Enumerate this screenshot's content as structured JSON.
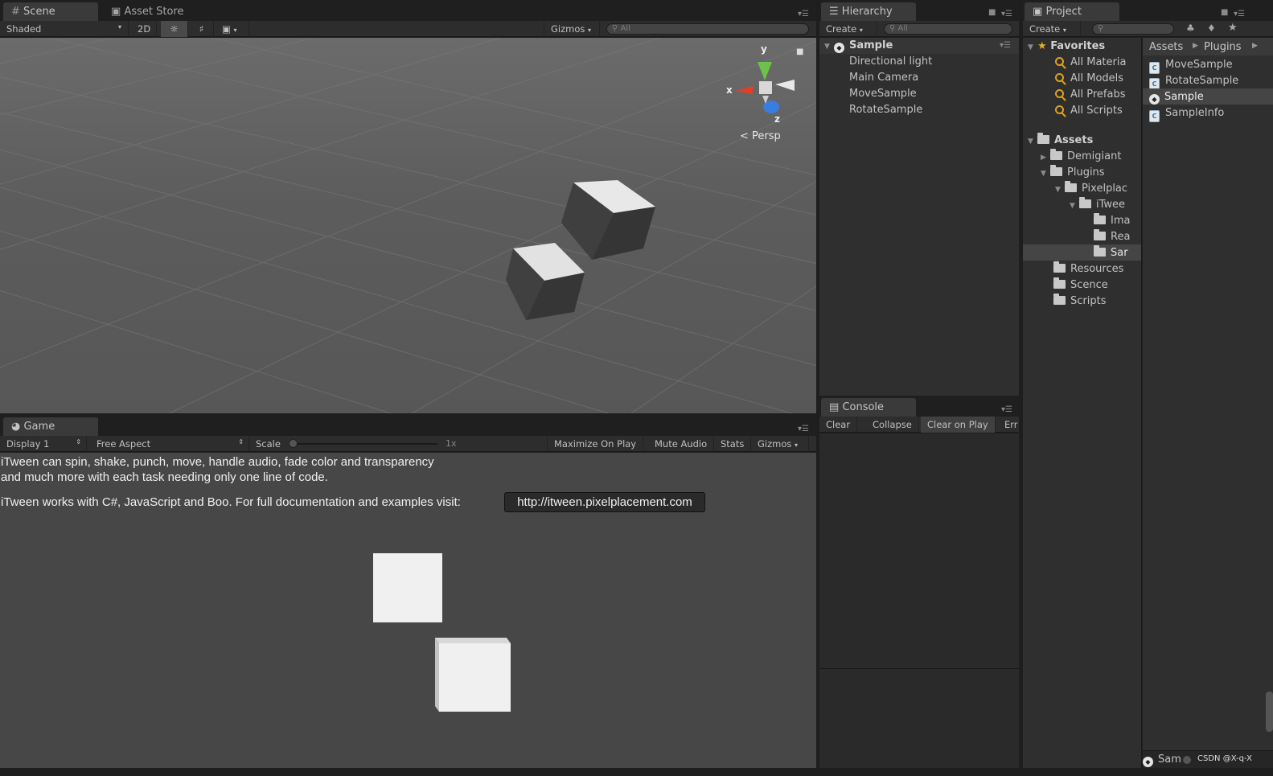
{
  "scene": {
    "tab_scene": "Scene",
    "tab_asset_store": "Asset Store",
    "toolbar": {
      "shading": "Shaded",
      "mode_2d": "2D",
      "gizmos": "Gizmos",
      "search": "All"
    },
    "persp_label": "Persp",
    "gizmo_axes": {
      "x": "x",
      "y": "y",
      "z": "z"
    }
  },
  "game": {
    "tab": "Game",
    "toolbar": {
      "display": "Display 1",
      "aspect": "Free Aspect",
      "scale_label": "Scale",
      "scale_value": "1x",
      "maximize": "Maximize On Play",
      "mute": "Mute Audio",
      "stats": "Stats",
      "gizmos": "Gizmos"
    },
    "text_line1": "iTween can spin, shake, punch, move, handle audio, fade color and transparency",
    "text_line2": "and much more with each task needing only one line of code.",
    "text_line3": "iTween works with C#, JavaScript and Boo. For full documentation and examples visit:",
    "link": "http://itween.pixelplacement.com"
  },
  "hierarchy": {
    "tab": "Hierarchy",
    "create": "Create",
    "search": "All",
    "scene_name": "Sample",
    "items": [
      "Directional light",
      "Main Camera",
      "MoveSample",
      "RotateSample"
    ]
  },
  "console": {
    "tab": "Console",
    "buttons": {
      "clear": "Clear",
      "collapse": "Collapse",
      "clear_on_play": "Clear on Play",
      "error_pause": "Err"
    }
  },
  "project": {
    "tab": "Project",
    "create": "Create",
    "favorites_label": "Favorites",
    "favorites": [
      "All Materia",
      "All Models",
      "All Prefabs",
      "All Scripts"
    ],
    "assets_label": "Assets",
    "tree": {
      "demigiant": "Demigiant",
      "plugins": "Plugins",
      "pixelplacement": "Pixelplac",
      "itween": "iTwee",
      "images": "Ima",
      "readme": "Rea",
      "sample": "Sar",
      "resources": "Resources",
      "scence": "Scence",
      "scripts": "Scripts"
    },
    "breadcrumb": [
      "Assets",
      "Plugins"
    ],
    "files": [
      "MoveSample",
      "RotateSample",
      "Sample",
      "SampleInfo"
    ],
    "status": "Sam",
    "watermark": "CSDN @X-q-X"
  }
}
